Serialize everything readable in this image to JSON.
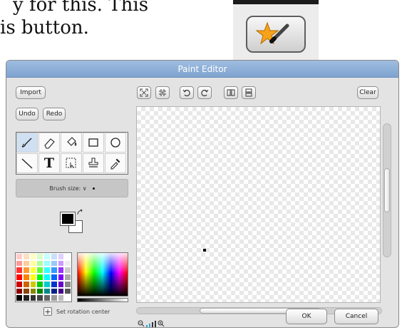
{
  "caption": {
    "line1": "y for this. This",
    "line2": "is button."
  },
  "dialog": {
    "title": "Paint Editor",
    "import_label": "Import",
    "undo_label": "Undo",
    "redo_label": "Redo",
    "clear_label": "Clear",
    "brush_size_label": "Brush size: ∨",
    "rotation_label": "Set rotation center",
    "ok_label": "OK",
    "cancel_label": "Cancel",
    "tool_text_glyph": "T"
  },
  "colors": {
    "accent_title": "#8fb1dc",
    "foreground": "#000000",
    "background": "#ffffff",
    "selected_tool": "#cfe0f2"
  },
  "palette": [
    "#ffcccc",
    "#ffe0c0",
    "#ffffc0",
    "#d8ffc8",
    "#c8ffff",
    "#c8e0ff",
    "#e0d0ff",
    "#ffffff",
    "#ff9999",
    "#ffcc99",
    "#ffff99",
    "#b0ff99",
    "#99ffff",
    "#99c8ff",
    "#cc99ff",
    "#eeeeee",
    "#ff3333",
    "#ff9933",
    "#ffff33",
    "#66ff33",
    "#33ffff",
    "#3399ff",
    "#9933ff",
    "#cccccc",
    "#ff0000",
    "#ff8000",
    "#ffff00",
    "#00ff00",
    "#00ffff",
    "#0066ff",
    "#8000ff",
    "#aaaaaa",
    "#cc0000",
    "#cc6600",
    "#cccc00",
    "#00cc00",
    "#00cccc",
    "#0033cc",
    "#6600cc",
    "#888888",
    "#880000",
    "#884400",
    "#888800",
    "#008800",
    "#008888",
    "#002288",
    "#440088",
    "#555555",
    "#000000",
    "#222222",
    "#333333",
    "#444444",
    "#666666",
    "#999999",
    "#bbbbbb",
    "#ffffff"
  ]
}
